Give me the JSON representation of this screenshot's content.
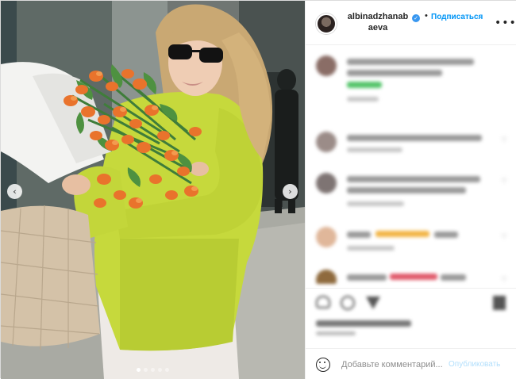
{
  "header": {
    "username": "albinadzhanabaeva",
    "separator": "•",
    "follow_label": "Подписаться",
    "more_icon": "more-horizontal-icon",
    "verified_icon": "verified-badge-icon"
  },
  "media": {
    "prev_icon": "chevron-left-icon",
    "next_icon": "chevron-right-icon",
    "carousel_count": 5,
    "carousel_active_index": 0
  },
  "comment_box": {
    "placeholder": "Добавьте комментарий...",
    "publish_label": "Опубликовать",
    "emoji_icon": "emoji-icon"
  },
  "colors": {
    "accent": "#0095f6",
    "publish_disabled": "#b2dffc",
    "border": "#dbdbdb"
  }
}
